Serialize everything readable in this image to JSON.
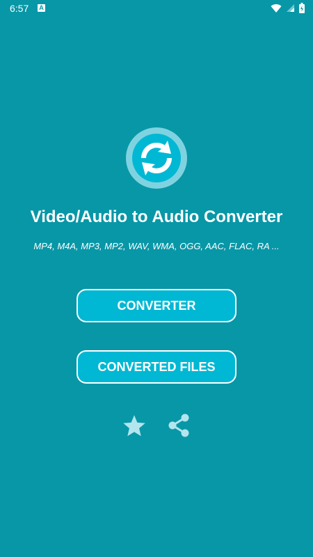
{
  "status_bar": {
    "time": "6:57",
    "notification_icon": "app-notification-icon",
    "icons": [
      "wifi-icon",
      "signal-icon",
      "battery-icon"
    ]
  },
  "app": {
    "logo_icon": "refresh-arrows-icon",
    "title": "Video/Audio to Audio Converter",
    "formats": "MP4, M4A, MP3, MP2, WAV, WMA, OGG, AAC, FLAC, RA ...",
    "converter_label": "CONVERTER",
    "converted_files_label": "CONVERTED FILES",
    "rate_icon": "star-icon",
    "share_icon": "share-icon"
  },
  "colors": {
    "background": "#0897A7",
    "button": "#01B8D4",
    "logo_ring": "#7FD3E0",
    "icons": "#B3E5EE"
  }
}
